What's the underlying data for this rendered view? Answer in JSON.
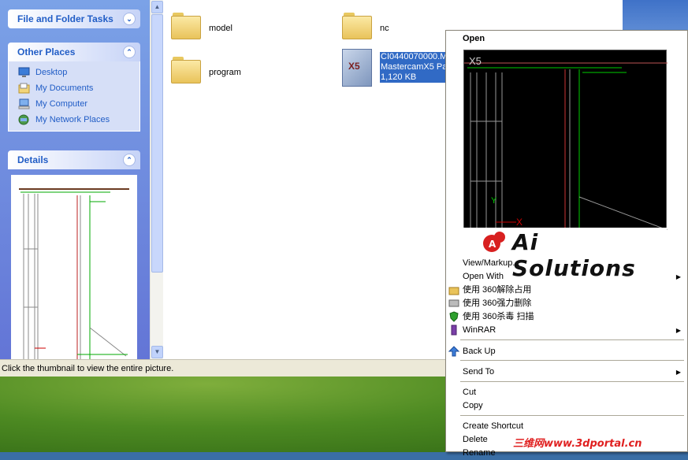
{
  "taskpane": {
    "file_folder_tasks": "File and Folder Tasks",
    "other_places": {
      "title": "Other Places",
      "items": [
        "Desktop",
        "My Documents",
        "My Computer",
        "My Network Places"
      ]
    },
    "details": {
      "title": "Details"
    }
  },
  "content": {
    "items": [
      {
        "label": "model",
        "icon": "folder-icon"
      },
      {
        "label": "nc",
        "icon": "folder-icon"
      },
      {
        "label": "program",
        "icon": "folder-icon"
      }
    ],
    "selected_file": {
      "name": "CI0440070000.M",
      "type": "MastercamX5 Par",
      "size": "1,120 KB",
      "icon": "mastercam-file-icon"
    }
  },
  "statusbar": {
    "text": "Click the thumbnail to view the entire picture."
  },
  "context_menu": {
    "open": "Open",
    "preview_label": "X5",
    "logo_text": "Ai Solutions",
    "items": {
      "view_markup": "View/Markup...",
      "open_with": "Open With",
      "unlock_360": "使用 360解除占用",
      "force_delete_360": "使用 360强力删除",
      "scan_360": "使用 360杀毒 扫描",
      "winrar": "WinRAR",
      "back_up": "Back Up",
      "send_to": "Send To",
      "cut": "Cut",
      "copy": "Copy",
      "create_shortcut": "Create Shortcut",
      "delete": "Delete",
      "rename": "Rename"
    }
  },
  "watermark": "三维网www.3dportal.cn",
  "colors": {
    "selection": "#316ac5",
    "link": "#215dc6",
    "accent_red": "#e02020"
  }
}
